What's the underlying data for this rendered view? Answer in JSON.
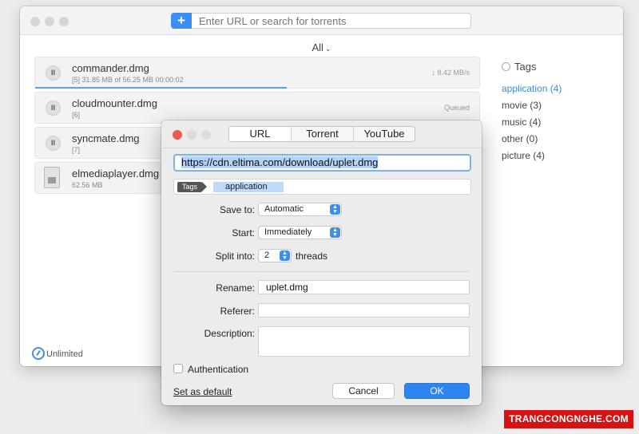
{
  "toolbar": {
    "add_symbol": "+",
    "search_placeholder": "Enter URL or search for torrents"
  },
  "filter": {
    "label": "All",
    "chevron": "⌄"
  },
  "downloads": [
    {
      "name": "commander.dmg",
      "meta": "[5] 31.85 MB of 56.25 MB  00:00:02",
      "status": "↓ 8.42 MB/s",
      "progress_fraction": 0.566,
      "icon": "pause-icon"
    },
    {
      "name": "cloudmounter.dmg",
      "meta": "[6]",
      "status": "Queued",
      "icon": "pause-icon"
    },
    {
      "name": "syncmate.dmg",
      "meta": "[7]",
      "status": "",
      "icon": "pause-icon"
    },
    {
      "name": "elmediaplayer.dmg",
      "meta": "62.56 MB",
      "status": "",
      "icon": "file-icon"
    }
  ],
  "tags_panel": {
    "title": "Tags",
    "items": [
      "application (4)",
      "movie (3)",
      "music (4)",
      "other (0)",
      "picture (4)"
    ],
    "active_index": 0
  },
  "speed_limit": "Unlimited",
  "dialog": {
    "tabs": [
      "URL",
      "Torrent",
      "YouTube"
    ],
    "selected_tab": "URL",
    "url_value": "https://cdn.eltima.com/download/uplet.dmg",
    "tags_label": "Tags",
    "tag_value": "application",
    "save_to_label": "Save to:",
    "save_to_value": "Automatic",
    "start_label": "Start:",
    "start_value": "Immediately",
    "split_label": "Split into:",
    "split_value": "2",
    "split_unit": "threads",
    "rename_label": "Rename:",
    "rename_value": "uplet.dmg",
    "referer_label": "Referer:",
    "referer_value": "",
    "description_label": "Description:",
    "description_value": "",
    "auth_label": "Authentication",
    "auth_checked": false,
    "set_default_label": "Set as default",
    "cancel_label": "Cancel",
    "ok_label": "OK"
  },
  "watermark": "TRANGCONGNGHE.COM",
  "colors": {
    "accent": "#2f85ef",
    "tag_active": "#3a8be6",
    "close_red": "#ee5a52",
    "watermark_red": "#d21414"
  }
}
